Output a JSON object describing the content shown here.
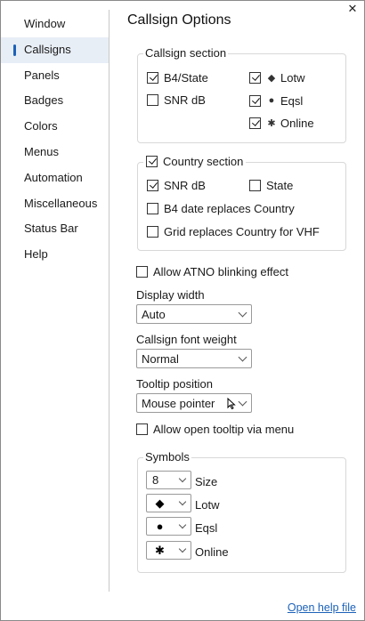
{
  "window": {
    "close_glyph": "✕"
  },
  "sidebar": {
    "items": [
      {
        "label": "Window"
      },
      {
        "label": "Callsigns",
        "active": true
      },
      {
        "label": "Panels"
      },
      {
        "label": "Badges"
      },
      {
        "label": "Colors"
      },
      {
        "label": "Menus"
      },
      {
        "label": "Automation"
      },
      {
        "label": "Miscellaneous"
      },
      {
        "label": "Status Bar"
      },
      {
        "label": "Help"
      }
    ]
  },
  "page": {
    "title": "Callsign Options"
  },
  "callsign_section": {
    "legend": "Callsign section",
    "b4_state": {
      "label": "B4/State",
      "checked": true
    },
    "snr_db": {
      "label": "SNR dB",
      "checked": false
    },
    "lotw": {
      "label": "Lotw",
      "checked": true,
      "icon": "diamond-icon"
    },
    "eqsl": {
      "label": "Eqsl",
      "checked": true,
      "icon": "circle-icon"
    },
    "online": {
      "label": "Online",
      "checked": true,
      "icon": "star-icon"
    }
  },
  "country_section": {
    "label": "Country section",
    "checked": true,
    "snr_db": {
      "label": "SNR dB",
      "checked": true
    },
    "state": {
      "label": "State",
      "checked": false
    },
    "b4_date": {
      "label": "B4 date replaces Country",
      "checked": false
    },
    "grid": {
      "label": "Grid replaces Country for VHF",
      "checked": false
    }
  },
  "atno_blink": {
    "label": "Allow ATNO blinking effect",
    "checked": false
  },
  "display_width": {
    "label": "Display width",
    "value": "Auto"
  },
  "font_weight": {
    "label": "Callsign font weight",
    "value": "Normal"
  },
  "tooltip_position": {
    "label": "Tooltip position",
    "value": "Mouse pointer"
  },
  "open_tooltip": {
    "label": "Allow open tooltip via menu",
    "checked": false
  },
  "symbols": {
    "legend": "Symbols",
    "size": {
      "value": "8",
      "label": "Size"
    },
    "lotw": {
      "glyph": "◆",
      "label": "Lotw",
      "icon": "diamond-icon"
    },
    "eqsl": {
      "glyph": "●",
      "label": "Eqsl",
      "icon": "circle-icon"
    },
    "online": {
      "glyph": "✱",
      "label": "Online",
      "icon": "star-icon"
    }
  },
  "footer": {
    "help_link": "Open help file"
  },
  "colors": {
    "accent": "#1c62b9",
    "active_bg": "#e8eef6"
  }
}
